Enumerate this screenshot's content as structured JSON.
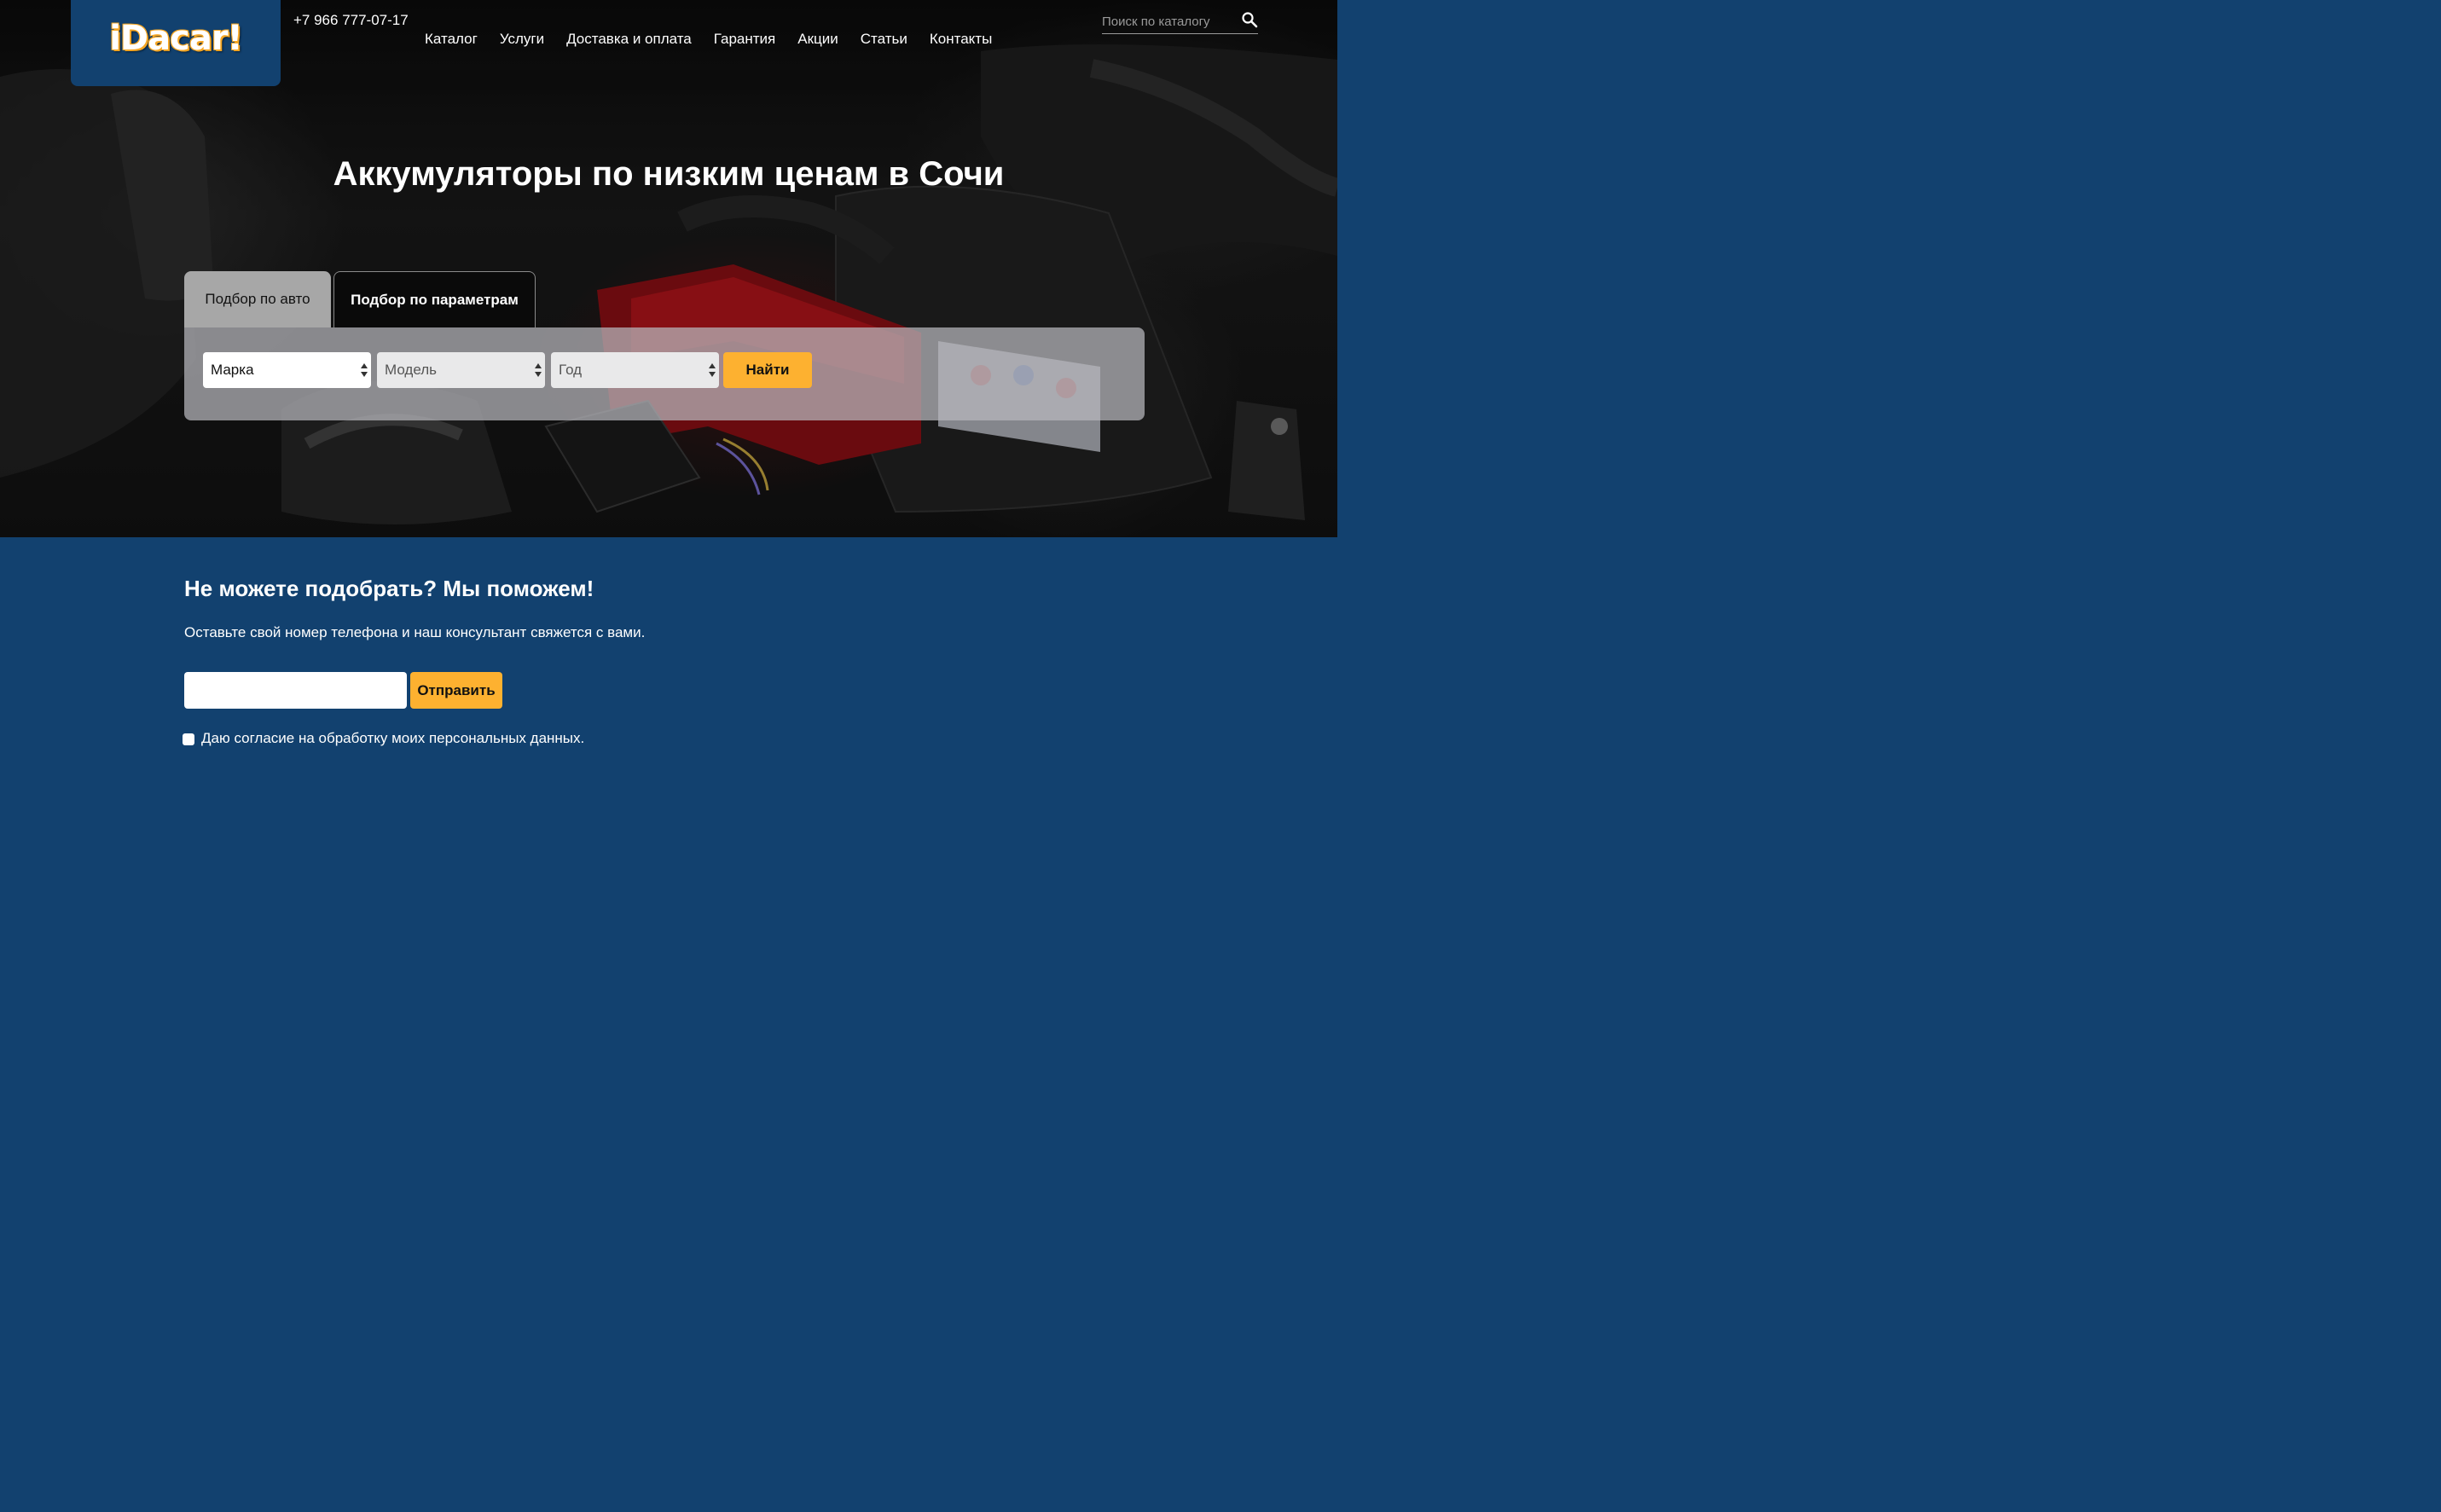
{
  "header": {
    "logo_text": "iDacar!",
    "phone": "+7 966 777-07-17",
    "nav": [
      "Каталог",
      "Услуги",
      "Доставка и оплата",
      "Гарантия",
      "Акции",
      "Статьи",
      "Контакты"
    ],
    "search_placeholder": "Поиск по каталогу"
  },
  "hero": {
    "title": "Аккумуляторы по низким ценам в Сочи"
  },
  "finder": {
    "tabs": [
      "Подбор по авто",
      "Подбор по параметрам"
    ],
    "active_tab": "Подбор по авто",
    "selects": {
      "brand": "Марка",
      "model": "Модель",
      "year": "Год"
    },
    "find_button": "Найти"
  },
  "callback": {
    "title": "Не можете подобрать? Мы поможем!",
    "subtitle": "Оставьте свой номер телефона и наш консультант свяжется с вами.",
    "phone_value": "",
    "send_button": "Отправить",
    "consent_label": "Даю согласие на обработку моих персональных данных.",
    "consent_checked": false
  },
  "colors": {
    "brand_blue": "#12416f",
    "accent_orange": "#fdb130"
  },
  "icons": [
    "search-icon",
    "select-arrows-icon"
  ]
}
